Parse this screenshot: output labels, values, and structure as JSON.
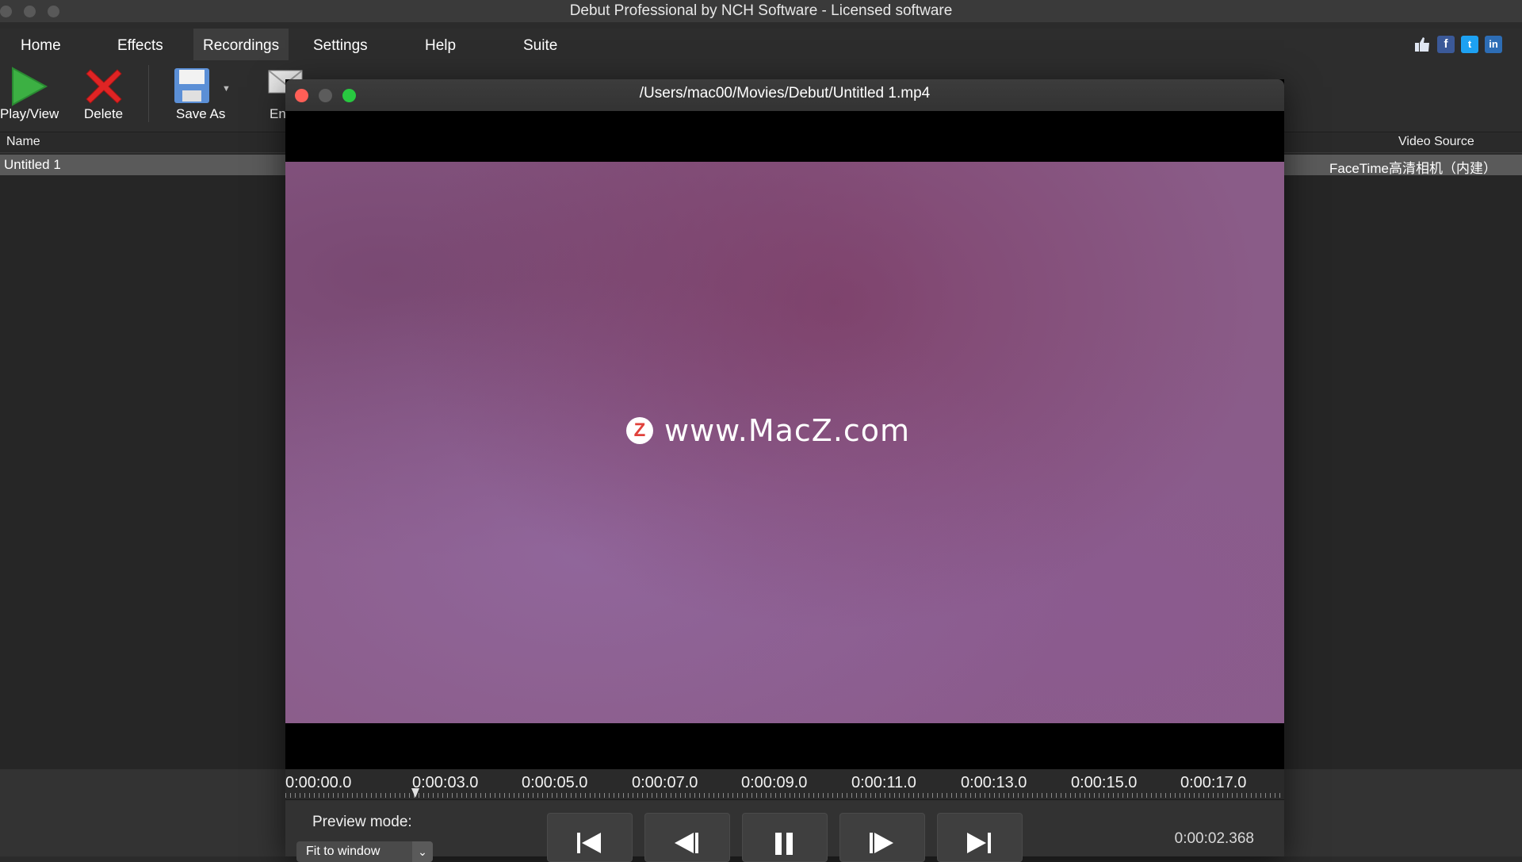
{
  "window": {
    "title": "Debut Professional by NCH Software - Licensed software"
  },
  "menu": {
    "items": [
      "Home",
      "Effects",
      "Recordings",
      "Settings",
      "Help",
      "Suite"
    ],
    "active": "Recordings"
  },
  "toolbar": {
    "play_label": "Play/View",
    "delete_label": "Delete",
    "saveas_label": "Save As",
    "email_label": "En"
  },
  "recordings_list": {
    "col_name": "Name",
    "col_source": "Video Source",
    "rows": [
      {
        "name": "Untitled 1",
        "source": "FaceTime高清相机（内建）"
      }
    ]
  },
  "player": {
    "title": "/Users/mac00/Movies/Debut/Untitled 1.mp4",
    "watermark_logo": "Z",
    "watermark_text": "www.MacZ.com",
    "timeline_labels": [
      "0:00:00.0",
      "0:00:03.0",
      "0:00:05.0",
      "0:00:07.0",
      "0:00:09.0",
      "0:00:11.0",
      "0:00:13.0",
      "0:00:15.0",
      "0:00:17.0"
    ],
    "preview_mode_label": "Preview mode:",
    "preview_mode_value": "Fit to window",
    "current_time": "0:00:02.368"
  },
  "colors": {
    "close": "#ff5f57",
    "minimize": "#5c5c5c",
    "zoom": "#28c840",
    "play_green": "#3cb043",
    "delete_red": "#e02424"
  }
}
